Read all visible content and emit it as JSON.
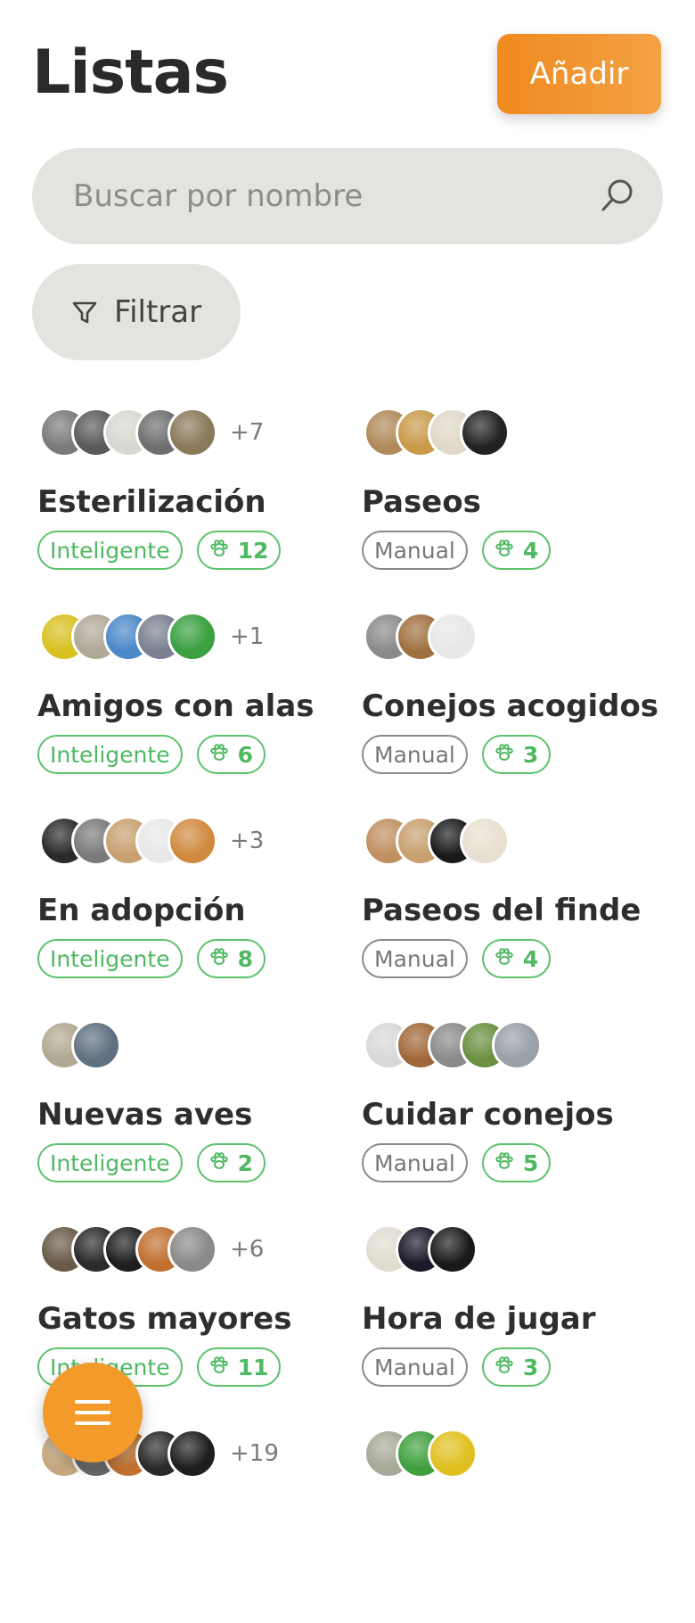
{
  "header": {
    "title": "Listas",
    "add_label": "Añadir"
  },
  "search": {
    "placeholder": "Buscar por nombre",
    "icon": "search-icon"
  },
  "filter": {
    "label": "Filtrar",
    "icon": "filter-icon"
  },
  "lists": [
    {
      "name": "Esterilización",
      "type": "Inteligente",
      "count": "12",
      "more": "+7",
      "avatars": [
        "#7a7a78",
        "#5a5a5a",
        "#d8d6d0",
        "#6e6e6e",
        "#8a7a5a"
      ]
    },
    {
      "name": "Paseos",
      "type": "Manual",
      "count": "4",
      "more": "",
      "avatars": [
        "#b08a5a",
        "#c89a4a",
        "#e0d8c8",
        "#222222"
      ]
    },
    {
      "name": "Amigos con alas",
      "type": "Inteligente",
      "count": "6",
      "more": "+1",
      "avatars": [
        "#d8c020",
        "#b0a898",
        "#4a88c8",
        "#7a8090",
        "#3aa040"
      ]
    },
    {
      "name": "Conejos acogidos",
      "type": "Manual",
      "count": "3",
      "more": "",
      "avatars": [
        "#8a8a8a",
        "#a07040",
        "#e8e8e8"
      ]
    },
    {
      "name": "En adopción",
      "type": "Inteligente",
      "count": "8",
      "more": "+3",
      "avatars": [
        "#2a2a2a",
        "#7a7a7a",
        "#c8a070",
        "#e8e8e8",
        "#d08a40"
      ]
    },
    {
      "name": "Paseos del finde",
      "type": "Manual",
      "count": "4",
      "more": "",
      "avatars": [
        "#c09060",
        "#c8a070",
        "#1a1a1a",
        "#e8e0d0"
      ]
    },
    {
      "name": "Nuevas aves",
      "type": "Inteligente",
      "count": "2",
      "more": "",
      "avatars": [
        "#b0a890",
        "#607080"
      ]
    },
    {
      "name": "Cuidar conejos",
      "type": "Manual",
      "count": "5",
      "more": "",
      "avatars": [
        "#d8d8d8",
        "#a06838",
        "#8a8a8a",
        "#6a9040",
        "#9aa0a8"
      ]
    },
    {
      "name": "Gatos mayores",
      "type": "Inteligente",
      "count": "11",
      "more": "+6",
      "avatars": [
        "#6a5a48",
        "#2a2a2a",
        "#1e1e1e",
        "#c07030",
        "#8a8a8a"
      ]
    },
    {
      "name": "Hora de jugar",
      "type": "Manual",
      "count": "3",
      "more": "",
      "avatars": [
        "#e0dcd0",
        "#1a1a2a",
        "#1a1a1a"
      ]
    },
    {
      "name": "",
      "type": "",
      "count": "",
      "more": "+19",
      "avatars": [
        "#c8a880",
        "#6a6a6a",
        "#c07030",
        "#2a2a2a",
        "#1e1e1e"
      ]
    },
    {
      "name": "",
      "type": "",
      "count": "",
      "more": "",
      "avatars": [
        "#a8a898",
        "#40a040",
        "#e0c020"
      ]
    }
  ],
  "fab": {
    "icon": "menu-icon"
  },
  "colors": {
    "accent": "#f29a2a",
    "smart_green": "#5cc26b",
    "manual_gray": "#8a8a8a",
    "field_bg": "#e4e3e0"
  }
}
